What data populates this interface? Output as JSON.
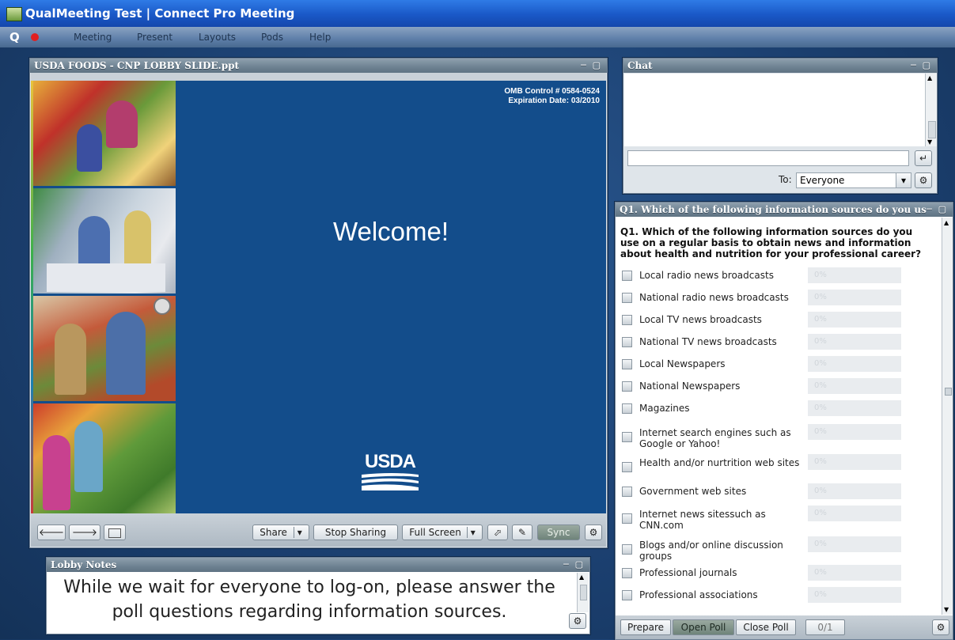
{
  "window": {
    "title": "QualMeeting Test | Connect Pro Meeting"
  },
  "menubar": {
    "logo": "Q",
    "items": [
      "Meeting",
      "Present",
      "Layouts",
      "Pods",
      "Help"
    ]
  },
  "share_pod": {
    "title": "USDA FOODS - CNP LOBBY SLIDE.ppt",
    "omb_control": "OMB Control # 0584-0524",
    "expiration": "Expiration Date:  03/2010",
    "welcome": "Welcome!",
    "logo_text": "USDA",
    "toolbar": {
      "share": "Share",
      "stop_sharing": "Stop Sharing",
      "full_screen": "Full Screen",
      "sync": "Sync"
    }
  },
  "chat_pod": {
    "title": "Chat",
    "to_label": "To:",
    "to_value": "Everyone"
  },
  "poll_pod": {
    "title": "Q1. Which of the following information sources do you us",
    "question": "Q1. Which of the following information sources do you use on a regular basis to obtain news and information about health and nutrition for your professional career?",
    "options": [
      {
        "label": "Local radio news broadcasts",
        "pct": "0%"
      },
      {
        "label": "National radio news broadcasts",
        "pct": "0%"
      },
      {
        "label": "Local TV news broadcasts",
        "pct": "0%"
      },
      {
        "label": "National TV news broadcasts",
        "pct": "0%"
      },
      {
        "label": "Local Newspapers",
        "pct": "0%"
      },
      {
        "label": "National Newspapers",
        "pct": "0%"
      },
      {
        "label": "Magazines",
        "pct": "0%"
      },
      {
        "label": "Internet search engines such as Google or Yahoo!",
        "pct": "0%"
      },
      {
        "label": "Health and/or nurtrition web sites",
        "pct": "0%"
      },
      {
        "label": "Government web sites",
        "pct": "0%"
      },
      {
        "label": "Internet news sitessuch as CNN.com",
        "pct": "0%"
      },
      {
        "label": "Blogs and/or online discussion groups",
        "pct": "0%"
      },
      {
        "label": "Professional journals",
        "pct": "0%"
      },
      {
        "label": "Professional associations",
        "pct": "0%"
      }
    ],
    "footer": {
      "prepare": "Prepare",
      "open_poll": "Open Poll",
      "close_poll": "Close Poll",
      "counter": "0/1"
    }
  },
  "notes_pod": {
    "title": "Lobby Notes",
    "text": "While we wait for everyone to log-on, please answer the poll questions regarding information sources."
  }
}
